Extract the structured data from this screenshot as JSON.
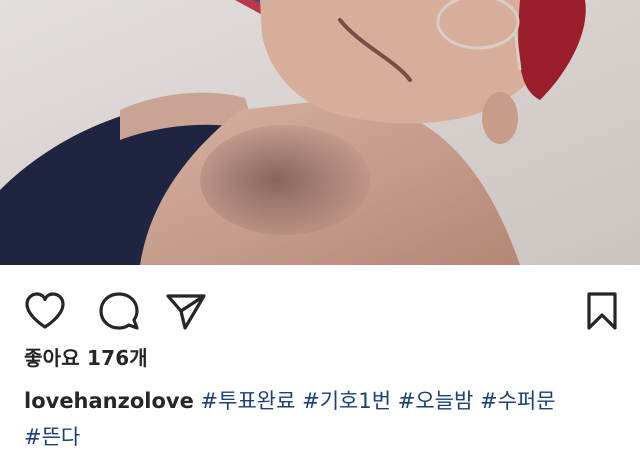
{
  "post": {
    "photo_icon": "selfie-photo",
    "likes_text": "좋아요 176개",
    "username": "lovehanzolove",
    "hashtags": [
      "#투표완료",
      "#기호1번",
      "#오늘밤",
      "#수퍼문",
      "#뜬다"
    ]
  },
  "actions": {
    "like_icon": "heart-icon",
    "comment_icon": "comment-icon",
    "share_icon": "send-icon",
    "save_icon": "bookmark-icon"
  },
  "colors": {
    "text": "#262626",
    "hashtag": "#1a3f7a",
    "background": "#ffffff"
  }
}
